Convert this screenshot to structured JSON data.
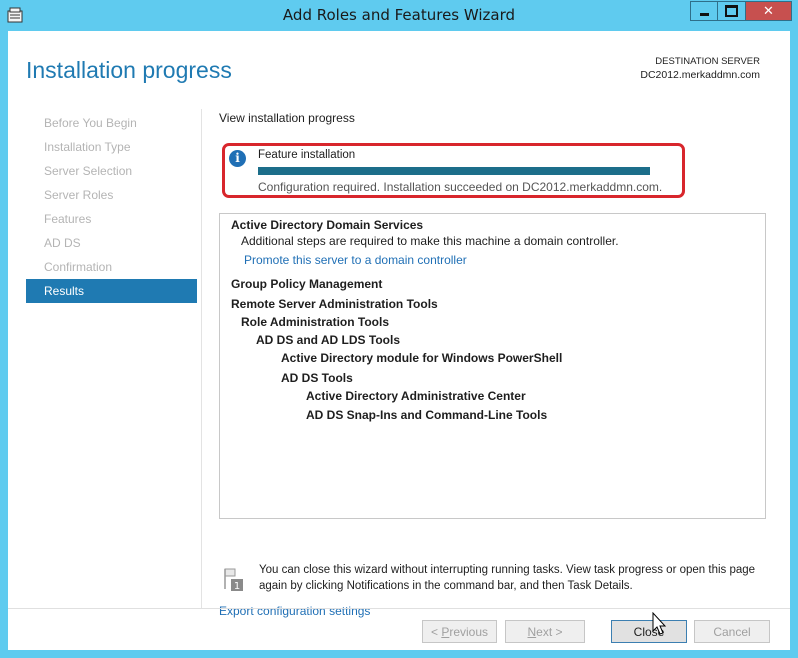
{
  "window": {
    "title": "Add Roles and Features Wizard",
    "close_glyph": "✕"
  },
  "header": {
    "page_title": "Installation progress",
    "destination_label": "DESTINATION SERVER",
    "destination_server": "DC2012.merkaddmn.com"
  },
  "nav": {
    "items": [
      {
        "label": "Before You Begin",
        "active": false
      },
      {
        "label": "Installation Type",
        "active": false
      },
      {
        "label": "Server Selection",
        "active": false
      },
      {
        "label": "Server Roles",
        "active": false
      },
      {
        "label": "Features",
        "active": false
      },
      {
        "label": "AD DS",
        "active": false
      },
      {
        "label": "Confirmation",
        "active": false
      },
      {
        "label": "Results",
        "active": true
      }
    ]
  },
  "main": {
    "section_heading": "View installation progress",
    "progress": {
      "info_glyph": "i",
      "label": "Feature installation",
      "percent": 100,
      "status": "Configuration required. Installation succeeded on DC2012.merkaddmn.com."
    },
    "results": [
      {
        "text": "Active Directory Domain Services",
        "bold": true,
        "link": false,
        "indent": 0
      },
      {
        "text": "Additional steps are required to make this machine a domain controller.",
        "bold": false,
        "link": false,
        "indent": 1
      },
      {
        "text": "Promote this server to a domain controller",
        "bold": false,
        "link": true,
        "indent": 1
      },
      {
        "text": "Group Policy Management",
        "bold": true,
        "link": false,
        "indent": 0
      },
      {
        "text": "Remote Server Administration Tools",
        "bold": true,
        "link": false,
        "indent": 0
      },
      {
        "text": "Role Administration Tools",
        "bold": true,
        "link": false,
        "indent": 1
      },
      {
        "text": "AD DS and AD LDS Tools",
        "bold": true,
        "link": false,
        "indent": 2
      },
      {
        "text": "Active Directory module for Windows PowerShell",
        "bold": true,
        "link": false,
        "indent": 3
      },
      {
        "text": "AD DS Tools",
        "bold": true,
        "link": false,
        "indent": 3
      },
      {
        "text": "Active Directory Administrative Center",
        "bold": true,
        "link": false,
        "indent": 4
      },
      {
        "text": "AD DS Snap-Ins and Command-Line Tools",
        "bold": true,
        "link": false,
        "indent": 4
      }
    ],
    "notice_badge": "1",
    "notice_text": "You can close this wizard without interrupting running tasks. View task progress or open this page again by clicking Notifications in the command bar, and then Task Details.",
    "export_link": "Export configuration settings"
  },
  "buttons": {
    "previous": {
      "prefix": "< ",
      "accel": "P",
      "rest": "revious"
    },
    "next": {
      "accel": "N",
      "rest": "ext >"
    },
    "close": "Close",
    "cancel": "Cancel"
  },
  "colors": {
    "accent": "#1f7ab2",
    "highlight_border": "#d8262c",
    "progress_fill": "#1c6e8a",
    "titlebar": "#5fcbef"
  }
}
